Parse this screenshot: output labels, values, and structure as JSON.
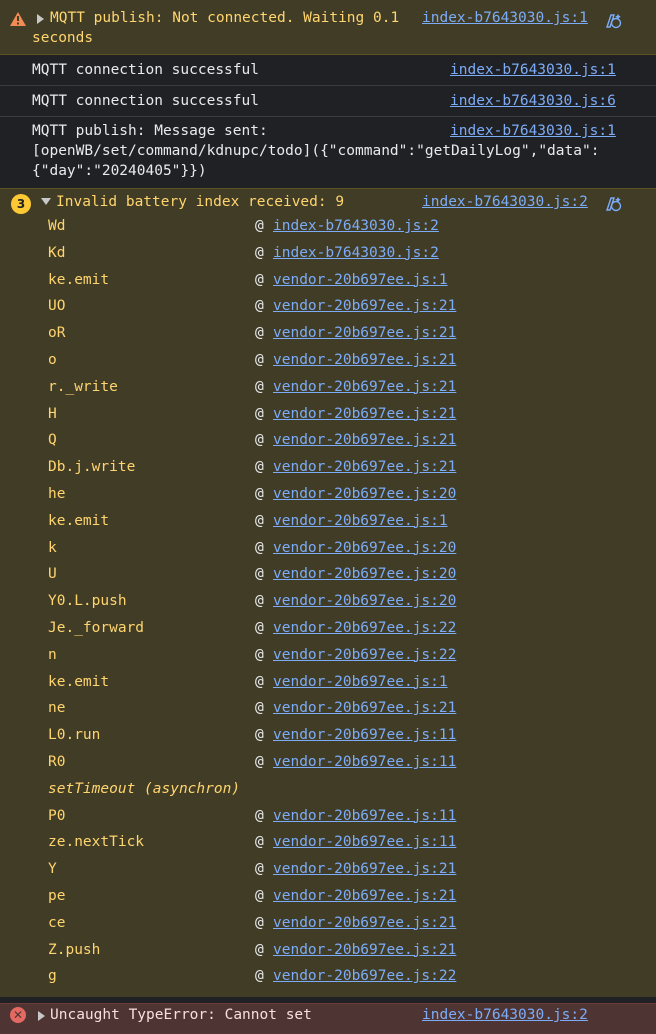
{
  "warning": {
    "text_line1": "MQTT publish: Not connected. Waiting 0.1",
    "text_line2": "seconds",
    "source": "index-b7643030.js:1"
  },
  "info_messages": [
    {
      "text": "MQTT connection successful",
      "source": "index-b7643030.js:1"
    },
    {
      "text": "MQTT connection successful",
      "source": "index-b7643030.js:6"
    },
    {
      "text_line1": "MQTT publish: Message sent:",
      "text_line2": "[openWB/set/command/kdnupc/todo]({\"command\":\"getDailyLog\",\"data\":",
      "text_line3": "{\"day\":\"20240405\"}})",
      "source": "index-b7643030.js:1"
    }
  ],
  "error_group": {
    "count": "3",
    "title": "Invalid battery index received: 9",
    "source": "index-b7643030.js:2",
    "stack": [
      {
        "fn": "Wd",
        "at": "@",
        "src": "index-b7643030.js:2"
      },
      {
        "fn": "Kd",
        "at": "@",
        "src": "index-b7643030.js:2"
      },
      {
        "fn": "ke.emit",
        "at": "@",
        "src": "vendor-20b697ee.js:1"
      },
      {
        "fn": "UO",
        "at": "@",
        "src": "vendor-20b697ee.js:21"
      },
      {
        "fn": "oR",
        "at": "@",
        "src": "vendor-20b697ee.js:21"
      },
      {
        "fn": "o",
        "at": "@",
        "src": "vendor-20b697ee.js:21"
      },
      {
        "fn": "r._write",
        "at": "@",
        "src": "vendor-20b697ee.js:21"
      },
      {
        "fn": "H",
        "at": "@",
        "src": "vendor-20b697ee.js:21"
      },
      {
        "fn": "Q",
        "at": "@",
        "src": "vendor-20b697ee.js:21"
      },
      {
        "fn": "Db.j.write",
        "at": "@",
        "src": "vendor-20b697ee.js:21"
      },
      {
        "fn": "he",
        "at": "@",
        "src": "vendor-20b697ee.js:20"
      },
      {
        "fn": "ke.emit",
        "at": "@",
        "src": "vendor-20b697ee.js:1"
      },
      {
        "fn": "k",
        "at": "@",
        "src": "vendor-20b697ee.js:20"
      },
      {
        "fn": "U",
        "at": "@",
        "src": "vendor-20b697ee.js:20"
      },
      {
        "fn": "Y0.L.push",
        "at": "@",
        "src": "vendor-20b697ee.js:20"
      },
      {
        "fn": "Je._forward",
        "at": "@",
        "src": "vendor-20b697ee.js:22"
      },
      {
        "fn": "n",
        "at": "@",
        "src": "vendor-20b697ee.js:22"
      },
      {
        "fn": "ke.emit",
        "at": "@",
        "src": "vendor-20b697ee.js:1"
      },
      {
        "fn": "ne",
        "at": "@",
        "src": "vendor-20b697ee.js:21"
      },
      {
        "fn": "L0.run",
        "at": "@",
        "src": "vendor-20b697ee.js:11"
      },
      {
        "fn": "R0",
        "at": "@",
        "src": "vendor-20b697ee.js:11"
      },
      {
        "fn": "setTimeout (asynchron)",
        "at": "",
        "src": "",
        "async": true
      },
      {
        "fn": "P0",
        "at": "@",
        "src": "vendor-20b697ee.js:11"
      },
      {
        "fn": "ze.nextTick",
        "at": "@",
        "src": "vendor-20b697ee.js:11"
      },
      {
        "fn": "Y",
        "at": "@",
        "src": "vendor-20b697ee.js:21"
      },
      {
        "fn": "pe",
        "at": "@",
        "src": "vendor-20b697ee.js:21"
      },
      {
        "fn": "ce",
        "at": "@",
        "src": "vendor-20b697ee.js:21"
      },
      {
        "fn": "Z.push",
        "at": "@",
        "src": "vendor-20b697ee.js:21"
      },
      {
        "fn": "g",
        "at": "@",
        "src": "vendor-20b697ee.js:22"
      }
    ]
  },
  "uncaught": {
    "text": "Uncaught TypeError: Cannot set",
    "source": "index-b7643030.js:2"
  },
  "colors": {
    "warning_bg": "#413c26",
    "warning_text": "#ffd56f",
    "link": "#7cacf8",
    "error_bg": "#4e3534"
  },
  "icons": {
    "warning": "warning-triangle-icon",
    "ai_explain": "ai-sparkle-icon",
    "badge": "count-badge",
    "error": "error-x-icon"
  }
}
